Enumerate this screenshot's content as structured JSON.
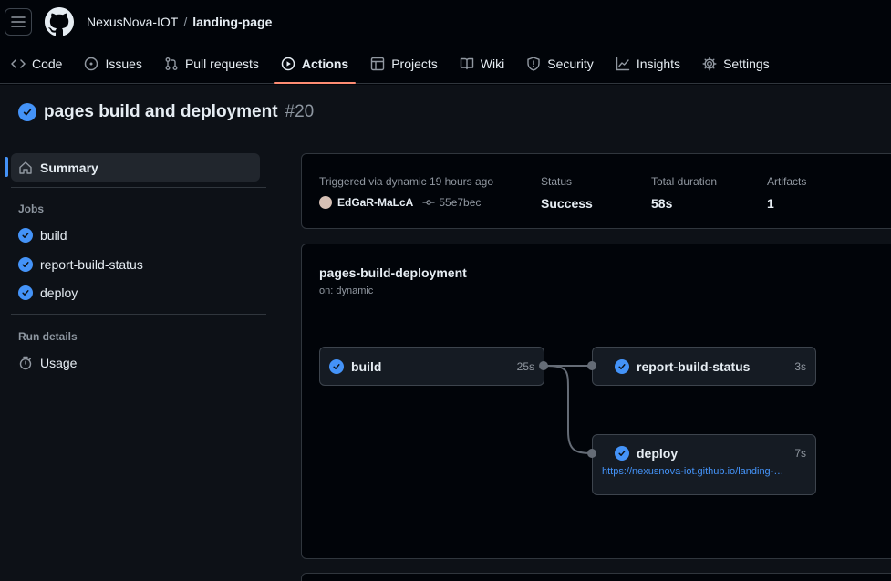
{
  "header": {
    "owner": "NexusNova-IOT",
    "separator": "/",
    "repo": "landing-page"
  },
  "tabs": [
    {
      "label": "Code",
      "icon": "code-icon"
    },
    {
      "label": "Issues",
      "icon": "issue-opened-icon"
    },
    {
      "label": "Pull requests",
      "icon": "git-pull-request-icon"
    },
    {
      "label": "Actions",
      "icon": "play-icon",
      "active": true
    },
    {
      "label": "Projects",
      "icon": "table-icon"
    },
    {
      "label": "Wiki",
      "icon": "book-icon"
    },
    {
      "label": "Security",
      "icon": "shield-icon"
    },
    {
      "label": "Insights",
      "icon": "graph-icon"
    },
    {
      "label": "Settings",
      "icon": "gear-icon"
    }
  ],
  "run": {
    "title": "pages build and deployment",
    "number": "#20"
  },
  "sidebar": {
    "summary": "Summary",
    "jobs_heading": "Jobs",
    "jobs": [
      "build",
      "report-build-status",
      "deploy"
    ],
    "run_details_heading": "Run details",
    "usage": "Usage"
  },
  "summary": {
    "triggered_label": "Triggered via dynamic 19 hours ago",
    "actor": "EdGaR-MaLcA",
    "commit": "55e7bec",
    "status_label": "Status",
    "status_value": "Success",
    "duration_label": "Total duration",
    "duration_value": "58s",
    "artifacts_label": "Artifacts",
    "artifacts_value": "1"
  },
  "workflow": {
    "name": "pages-build-deployment",
    "trigger": "on: dynamic",
    "jobs": {
      "build": {
        "name": "build",
        "duration": "25s"
      },
      "report": {
        "name": "report-build-status",
        "duration": "3s"
      },
      "deploy": {
        "name": "deploy",
        "duration": "7s",
        "url": "https://nexusnova-iot.github.io/landing-…"
      }
    }
  },
  "colors": {
    "accent": "#4493f8",
    "active_tab_underline": "#fd8c73",
    "background": "#0d1117"
  }
}
